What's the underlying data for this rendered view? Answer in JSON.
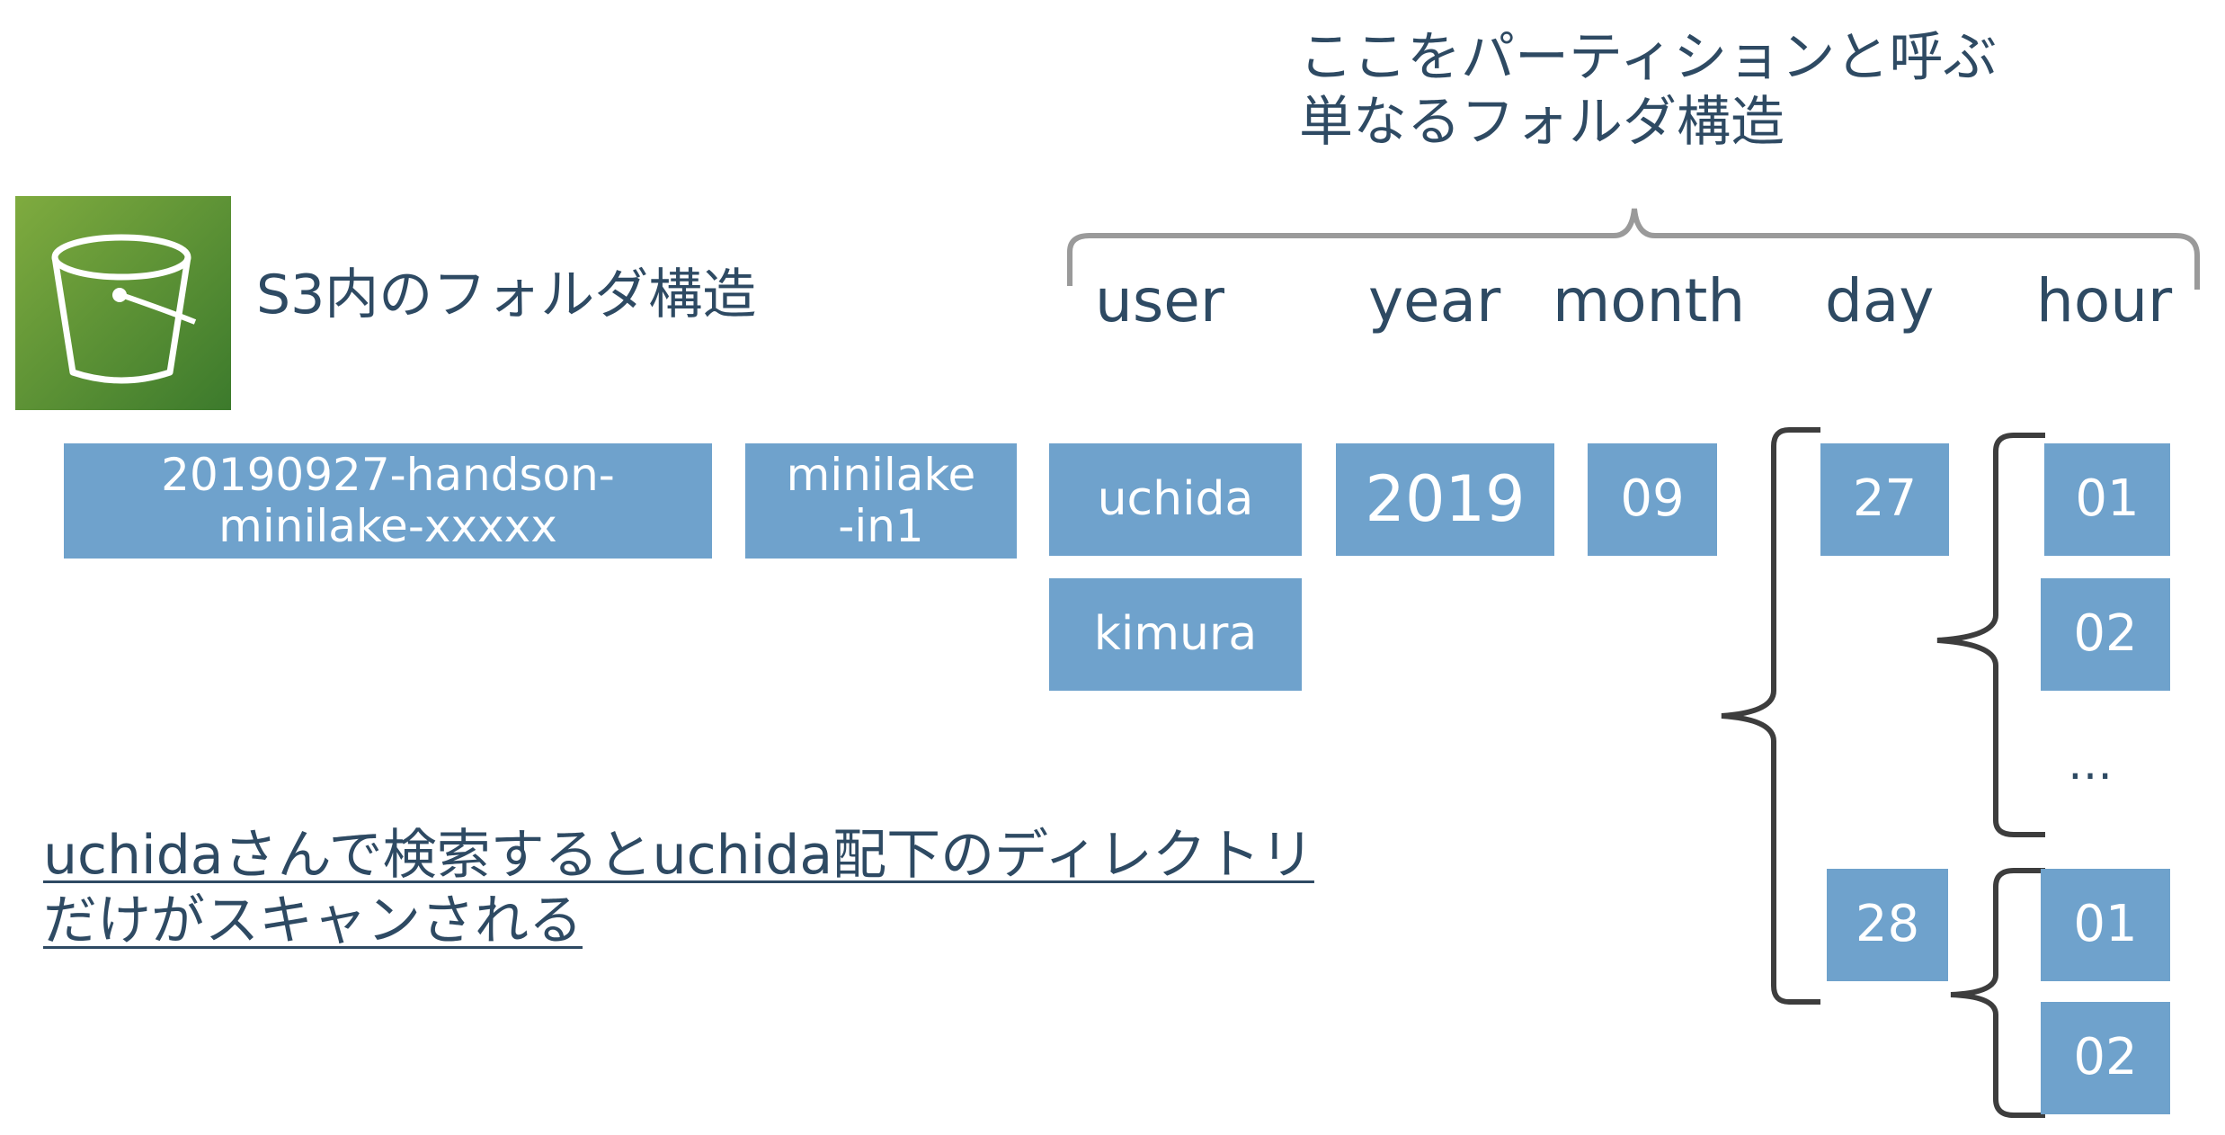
{
  "partition_label": "ここをパーティションと呼ぶ\n単なるフォルダ構造",
  "bucket_title": "S3内のフォルダ構造",
  "levels": {
    "user": "user",
    "year": "year",
    "month": "month",
    "day": "day",
    "hour": "hour"
  },
  "boxes": {
    "bucket_line1": "20190927-handson-",
    "bucket_line2": "minilake-xxxxx",
    "folder_line1": "minilake",
    "folder_line2": "-in1",
    "user1": "uchida",
    "user2": "kimura",
    "year": "2019",
    "month": "09",
    "day1": "27",
    "day2": "28",
    "hour_27_1": "01",
    "hour_27_2": "02",
    "hour_28_1": "01",
    "hour_28_2": "02"
  },
  "ellipsis": "…",
  "note": "uchidaさんで検索するとuchida配下のディレクトリ\nだけがスキャンされる",
  "colors": {
    "box": "#6fa2cc",
    "text": "#2e4a63",
    "bracket": "#3d3d3d",
    "top_bracket": "#9a9a9a",
    "icon_green": "#5a9236"
  },
  "icons": [
    "s3-bucket-icon"
  ]
}
